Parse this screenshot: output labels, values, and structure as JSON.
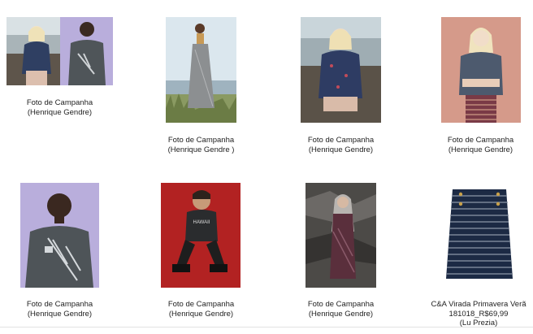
{
  "gallery": {
    "items": [
      {
        "caption_line1": "Foto de Campanha",
        "caption_line2": "(Henrique Gendre)",
        "image_alt": "Two models posing side by side"
      },
      {
        "caption_line1": "Foto de Campanha",
        "caption_line2": "(Henrique Gendre )",
        "image_alt": "Model standing in grass by the sea"
      },
      {
        "caption_line1": "Foto de Campanha",
        "caption_line2": "(Henrique Gendre)",
        "image_alt": "Model seated on rocks by the sea"
      },
      {
        "caption_line1": "Foto de Campanha",
        "caption_line2": "(Henrique Gendre)",
        "image_alt": "Model with arms crossed on pink background"
      },
      {
        "caption_line1": "Foto de Campanha",
        "caption_line2": "(Henrique Gendre)",
        "image_alt": "Male model in printed t-shirt on lilac background"
      },
      {
        "caption_line1": "Foto de Campanha",
        "caption_line2": "(Henrique Gendre)",
        "image_alt": "Male model seated on red background"
      },
      {
        "caption_line1": "Foto de Campanha",
        "caption_line2": "(Henrique Gendre)",
        "image_alt": "Model seated on dark rocks"
      },
      {
        "caption_line1": "C&A Virada Primavera Verã",
        "caption_line2": "181018_R$69,99",
        "caption_line3": "(Lu Prezia)",
        "image_alt": "Striped navy skirt product photo"
      }
    ]
  },
  "colors": {
    "lilac_backdrop": "#b9aedc",
    "sky": "#dbe7ee",
    "pink_backdrop": "#d59a8a",
    "red_backdrop": "#b22222",
    "rock": "#4c4a47",
    "navy": "#1c2a44"
  }
}
